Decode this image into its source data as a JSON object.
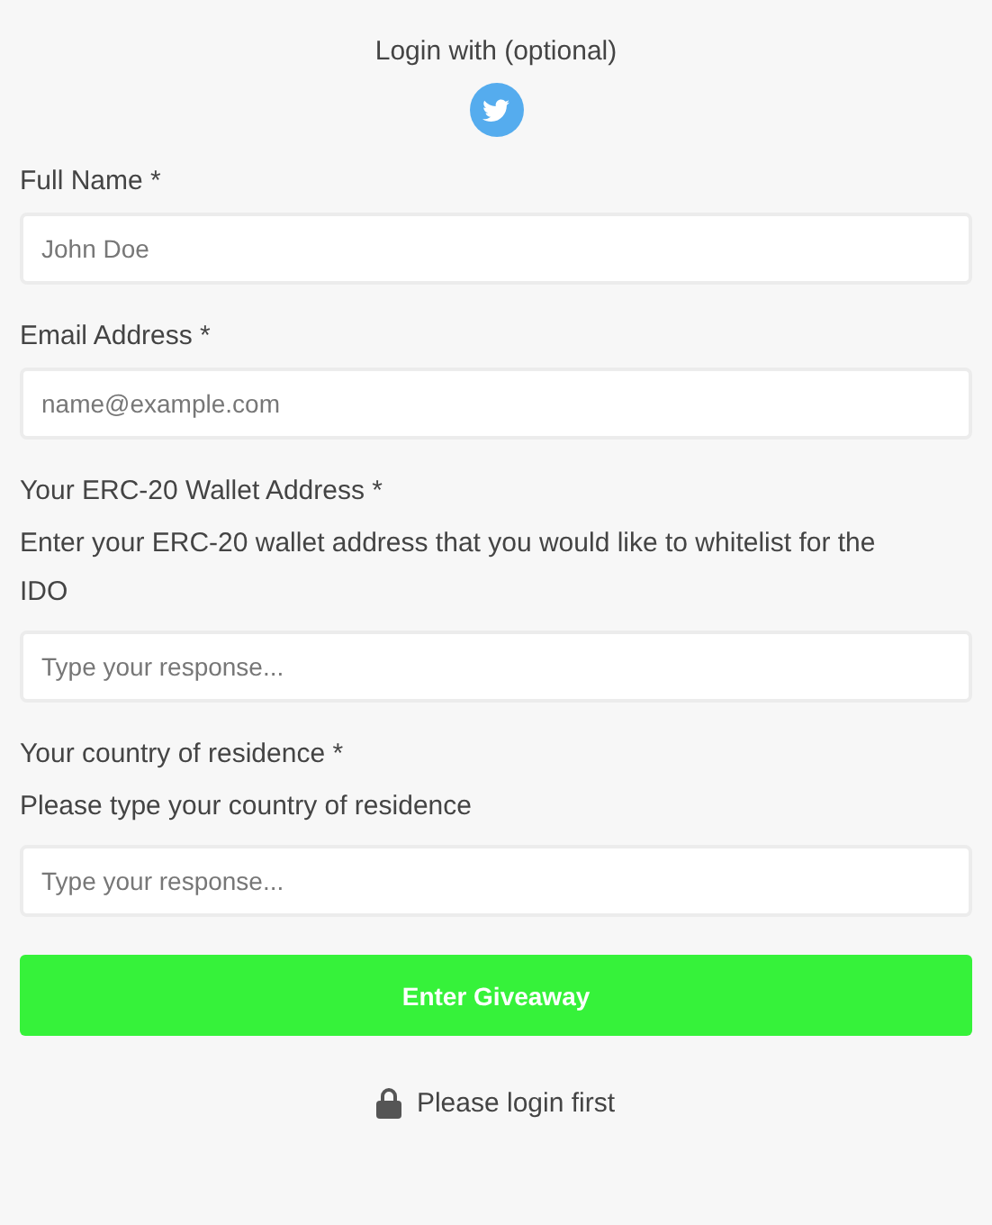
{
  "login_header": {
    "text": "Login with (optional)"
  },
  "fields": [
    {
      "label": "Full Name *",
      "placeholder": "John Doe"
    },
    {
      "label": "Email Address *",
      "placeholder": "name@example.com"
    },
    {
      "label": "Your ERC-20 Wallet Address *",
      "description": "Enter your ERC-20 wallet address that you would like to whitelist for the IDO",
      "placeholder": "Type your response..."
    },
    {
      "label": "Your country of residence *",
      "description": "Please type your country of residence",
      "placeholder": "Type your response..."
    }
  ],
  "submit_button": {
    "label": "Enter Giveaway"
  },
  "notice": {
    "text": "Please login first"
  }
}
